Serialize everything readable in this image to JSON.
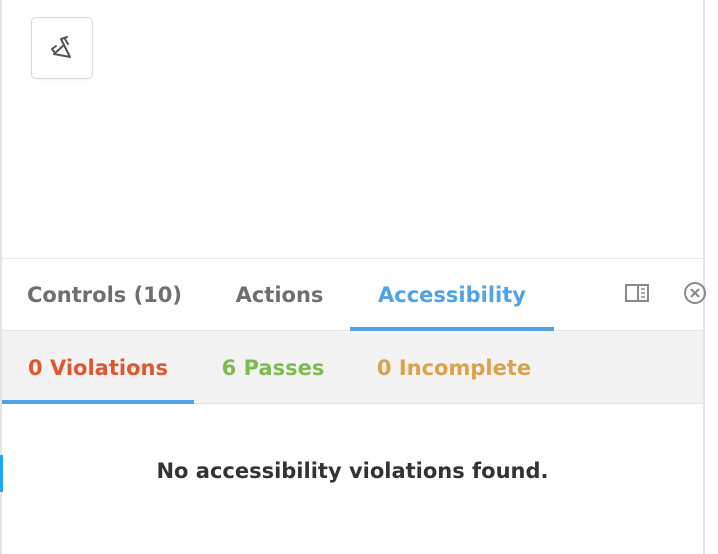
{
  "toolbar": {
    "megaphone_icon": "megaphone-icon"
  },
  "tabs": [
    {
      "label": "Controls (10)"
    },
    {
      "label": "Actions"
    },
    {
      "label": "Accessibility"
    }
  ],
  "panel_icons": {
    "layout": "panel-layout-icon",
    "close": "close-icon"
  },
  "subtabs": [
    {
      "label": "0 Violations",
      "color": "#e0562f"
    },
    {
      "label": "6 Passes",
      "color": "#7cbb4f"
    },
    {
      "label": "0 Incomplete",
      "color": "#dca24a"
    }
  ],
  "message": "No accessibility violations found.",
  "colors": {
    "accent": "#4ea3e9",
    "inactive_tab": "#6f6f6f"
  }
}
